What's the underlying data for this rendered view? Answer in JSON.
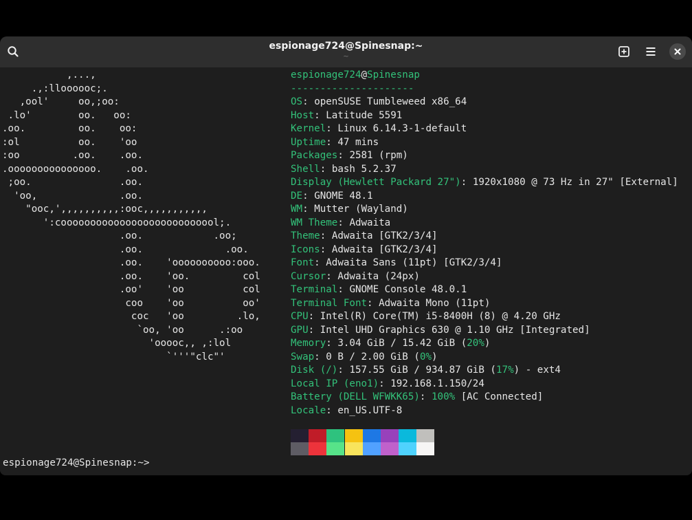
{
  "window": {
    "title": "espionage724@Spinesnap:~",
    "subtitle": "~"
  },
  "toolbar": {
    "search_icon": "search-icon",
    "new_tab_icon": "new-tab-icon",
    "menu_icon": "hamburger-menu-icon",
    "close_icon": "close-icon"
  },
  "logo_lines": [
    "           ,...,",
    "     .,:lloooooc;.",
    "   ,ool'     oo,;oo:",
    " .lo'        oo.   oo:",
    ".oo.         oo.    oo:",
    ":ol          oo.    'oo",
    ":oo         .oo.    .oo.",
    ".ooooooooooooooo.    .oo.",
    " ;oo.               .oo.",
    "  'oo,              .oo.",
    "    \"ooc,',,,,,,,,,,:ooc,,,,,,,,,,,",
    "       ':cooooooooooooooooooooooooool;.",
    "                    .oo.            .oo;",
    "                    .oo.              .oo.",
    "                    .oo.    'oooooooooo:ooo.",
    "                    .oo.    'oo.         col",
    "                    .oo'    'oo          col",
    "                     coo    'oo          oo'",
    "                      coc   'oo         .lo,",
    "                       `oo, 'oo      .:oo",
    "                         'ooooc,, ,:lol",
    "                            `'''\"clc\"'"
  ],
  "header": {
    "user": "espionage724",
    "at": "@",
    "host": "Spinesnap",
    "separator": "---------------------"
  },
  "info": [
    {
      "key": "OS",
      "value": "openSUSE Tumbleweed x86_64"
    },
    {
      "key": "Host",
      "value": "Latitude 5591"
    },
    {
      "key": "Kernel",
      "value": "Linux 6.14.3-1-default"
    },
    {
      "key": "Uptime",
      "value": "47 mins"
    },
    {
      "key": "Packages",
      "value": "2581 (rpm)"
    },
    {
      "key": "Shell",
      "value": "bash 5.2.37"
    },
    {
      "key": "Display (Hewlett Packard 27\")",
      "value": "1920x1080 @ 73 Hz in 27\" [External]"
    },
    {
      "key": "DE",
      "value": "GNOME 48.1"
    },
    {
      "key": "WM",
      "value": "Mutter (Wayland)"
    },
    {
      "key": "WM Theme",
      "value": "Adwaita"
    },
    {
      "key": "Theme",
      "value": "Adwaita [GTK2/3/4]"
    },
    {
      "key": "Icons",
      "value": "Adwaita [GTK2/3/4]"
    },
    {
      "key": "Font",
      "value": "Adwaita Sans (11pt) [GTK2/3/4]"
    },
    {
      "key": "Cursor",
      "value": "Adwaita (24px)"
    },
    {
      "key": "Terminal",
      "value": "GNOME Console 48.0.1"
    },
    {
      "key": "Terminal Font",
      "value": "Adwaita Mono (11pt)"
    },
    {
      "key": "CPU",
      "value": "Intel(R) Core(TM) i5-8400H (8) @ 4.20 GHz"
    },
    {
      "key": "GPU",
      "value": "Intel UHD Graphics 630 @ 1.10 GHz [Integrated]"
    },
    {
      "key": "Memory",
      "v1": "3.04 GiB / 15.42 GiB (",
      "pct": "20%",
      "v2": ")"
    },
    {
      "key": "Swap",
      "v1": "0 B / 2.00 GiB (",
      "pct": "0%",
      "v2": ")"
    },
    {
      "key": "Disk (/)",
      "v1": "157.55 GiB / 934.87 GiB (",
      "pct": "17%",
      "v2": ") - ext4"
    },
    {
      "key": "Local IP (eno1)",
      "value": "192.168.1.150/24"
    },
    {
      "key": "Battery (DELL WFWKK65)",
      "v1": "",
      "pct": "100%",
      "v2": " [AC Connected]"
    },
    {
      "key": "Locale",
      "value": "en_US.UTF-8"
    }
  ],
  "palette": {
    "top": [
      "#241f31",
      "#c01c28",
      "#2ec27e",
      "#f5c211",
      "#1e78e4",
      "#9841bb",
      "#0ab9dc",
      "#c0bfbc"
    ],
    "bottom": [
      "#5e5c64",
      "#ed333b",
      "#57e389",
      "#f8e45c",
      "#51a1ff",
      "#c061cb",
      "#4fd2fd",
      "#f6f5f4"
    ]
  },
  "prompt": "espionage724@Spinesnap:~>"
}
